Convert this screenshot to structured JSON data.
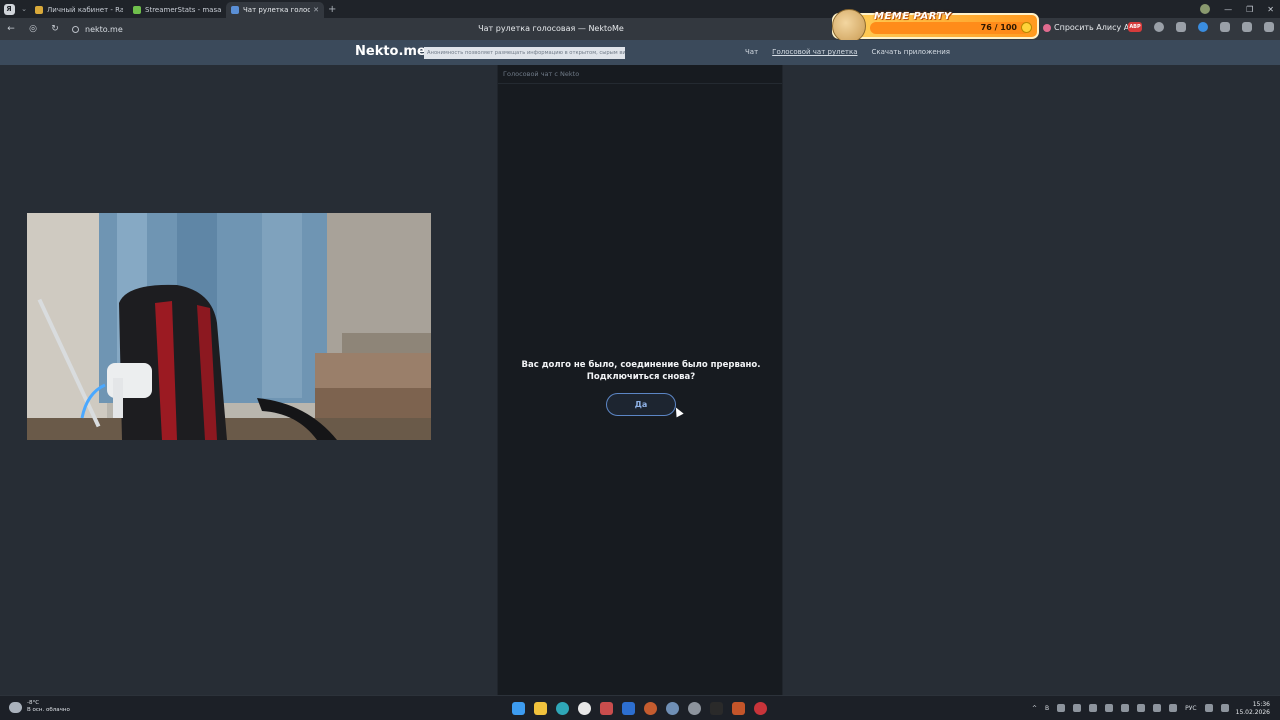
{
  "browser": {
    "tabs": [
      {
        "label": "Личный кабинет - Ramp",
        "color": "#d9a93a",
        "active": false
      },
      {
        "label": "StreamerStats - masadaz",
        "color": "#6fbf4c",
        "active": false
      },
      {
        "label": "Чат рулетка голосовая",
        "color": "#5a8fd6",
        "active": true
      }
    ],
    "tab_close": "✕",
    "new_tab": "+",
    "url": "nekto.me",
    "page_title": "Чат рулетка голосовая — NektoMe",
    "back": "←",
    "reload": "↻",
    "alice_label": "Спросить Алису AI",
    "abp": "ABP",
    "window_controls": {
      "minimize": "—",
      "maximize": "❐",
      "close": "✕"
    }
  },
  "meme_party": {
    "title": "MEME PARTY",
    "score": "76 / 100"
  },
  "site": {
    "logo": "Nekto.me",
    "notice": "Анонимность позволяет размещать информацию в открытом, сырым видe",
    "nav": [
      {
        "label": "Чат",
        "current": false
      },
      {
        "label": "Голосовой чат рулетка",
        "current": true
      },
      {
        "label": "Скачать приложения",
        "current": false
      }
    ]
  },
  "chat": {
    "panel_title": "Голосовой чат с Nekto",
    "message_line1": "Вас долго не было, соединение было прервано.",
    "message_line2": "Подключиться снова?",
    "yes_button": "Да"
  },
  "taskbar": {
    "temperature": "-8°C",
    "weather": "В осн. облачно",
    "language": "РУС",
    "time": "15:36",
    "date": "15.02.2026",
    "tray_b": "B"
  }
}
